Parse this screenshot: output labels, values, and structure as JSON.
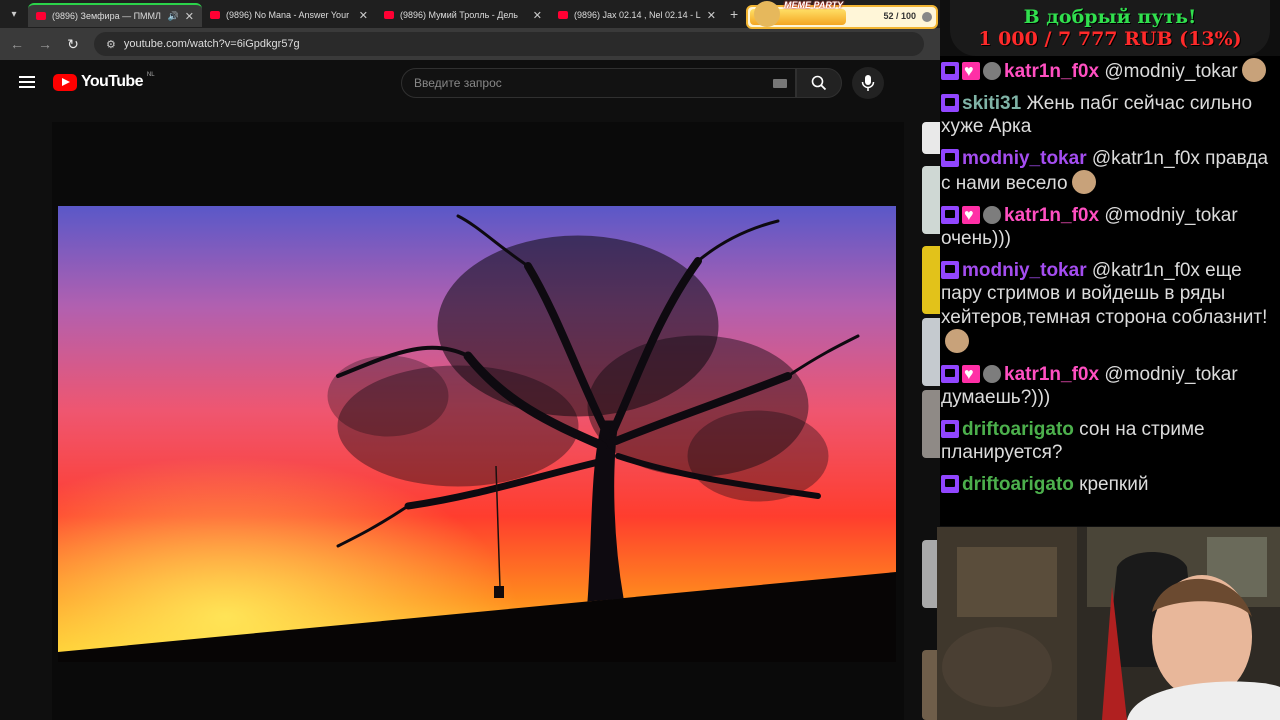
{
  "browser": {
    "tabs": [
      {
        "title": "(9896) Земфира — ПММЛ",
        "active": true,
        "audio": true
      },
      {
        "title": "(9896) No Mana - Answer Your",
        "active": false
      },
      {
        "title": "(9896) Мумий Тролль - Дель",
        "active": false
      },
      {
        "title": "(9896) Jax 02.14 , Nel 02.14 - L",
        "active": false
      }
    ],
    "url": "youtube.com/watch?v=6iGpdkgr57g"
  },
  "youtube": {
    "logo_text": "YouTube",
    "country_code": "NL",
    "search_placeholder": "Введите запрос"
  },
  "overlay": {
    "donation_title": "В добрый путь!",
    "donation_amount": "1 000 / 7 777 RUB (13%)",
    "meme_party_label": "MEME PARTY",
    "meme_party_count": "52 / 100",
    "meme_party_progress": 0.52
  },
  "chat": {
    "messages": [
      {
        "badges": [
          "twitch",
          "heart",
          "skull"
        ],
        "user": "katr1n_f0x",
        "color": "#ff4fc1",
        "text": "@modniy_tokar",
        "emote": true
      },
      {
        "badges": [
          "twitch"
        ],
        "user": "skiti31",
        "color": "#7fb3a6",
        "text": "Жень пабг сейчас сильно хуже Арка",
        "emote": false
      },
      {
        "badges": [
          "twitch"
        ],
        "user": "modniy_tokar",
        "color": "#a44df0",
        "text": "@katr1n_f0x правда с нами весело",
        "emote": true
      },
      {
        "badges": [
          "twitch",
          "heart",
          "skull"
        ],
        "user": "katr1n_f0x",
        "color": "#ff4fc1",
        "text": "@modniy_tokar очень)))",
        "emote": false
      },
      {
        "badges": [
          "twitch"
        ],
        "user": "modniy_tokar",
        "color": "#a44df0",
        "text": "@katr1n_f0x еще пару стримов и войдешь в ряды хейтеров,темная сторона соблазнит!",
        "emote": true
      },
      {
        "badges": [
          "twitch",
          "heart",
          "skull"
        ],
        "user": "katr1n_f0x",
        "color": "#ff4fc1",
        "text": "@modniy_tokar думаешь?)))",
        "emote": false
      },
      {
        "badges": [
          "twitch"
        ],
        "user": "driftoarigato",
        "color": "#4cb04c",
        "text": "сон на стриме планируется?",
        "emote": false
      },
      {
        "badges": [
          "twitch"
        ],
        "user": "driftoarigato",
        "color": "#4cb04c",
        "text": "крепкий",
        "emote": false
      }
    ]
  }
}
